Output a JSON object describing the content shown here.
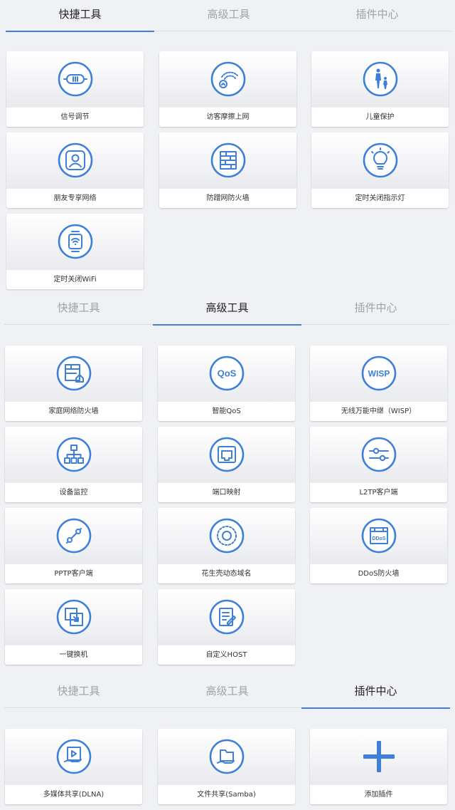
{
  "sections": [
    {
      "tabs": [
        {
          "label": "快捷工具",
          "active": true
        },
        {
          "label": "高级工具",
          "active": false
        },
        {
          "label": "插件中心",
          "active": false
        }
      ],
      "cards": [
        {
          "label": "信号调节",
          "icon": "signal-adjust-icon"
        },
        {
          "label": "访客摩擦上网",
          "icon": "guest-wifi-icon"
        },
        {
          "label": "儿童保护",
          "icon": "child-protect-icon"
        },
        {
          "label": "朋友专享网络",
          "icon": "friend-network-icon"
        },
        {
          "label": "防蹭网防火墙",
          "icon": "firewall-icon"
        },
        {
          "label": "定时关闭指示灯",
          "icon": "bulb-icon"
        },
        {
          "label": "定时关闭WiFi",
          "icon": "watch-wifi-icon"
        }
      ]
    },
    {
      "tabs": [
        {
          "label": "快捷工具",
          "active": false
        },
        {
          "label": "高级工具",
          "active": true
        },
        {
          "label": "插件中心",
          "active": false
        }
      ],
      "cards": [
        {
          "label": "家庭网络防火墙",
          "icon": "home-firewall-icon"
        },
        {
          "label": "智能QoS",
          "icon": "qos-icon",
          "icon_text": "QoS"
        },
        {
          "label": "无线万能中继（WISP）",
          "icon": "wisp-icon",
          "icon_text": "WISP"
        },
        {
          "label": "设备监控",
          "icon": "device-monitor-icon"
        },
        {
          "label": "端口映射",
          "icon": "port-mapping-icon"
        },
        {
          "label": "L2TP客户端",
          "icon": "sliders-icon"
        },
        {
          "label": "PPTP客户端",
          "icon": "link-icon"
        },
        {
          "label": "花生壳动态域名",
          "icon": "dynamic-dns-icon"
        },
        {
          "label": "DDoS防火墙",
          "icon": "ddos-icon",
          "icon_text": "DDoS"
        },
        {
          "label": "一键换机",
          "icon": "switch-device-icon"
        },
        {
          "label": "自定义HOST",
          "icon": "edit-host-icon"
        }
      ]
    },
    {
      "tabs": [
        {
          "label": "快捷工具",
          "active": false
        },
        {
          "label": "高级工具",
          "active": false
        },
        {
          "label": "插件中心",
          "active": true
        }
      ],
      "cards": [
        {
          "label": "多媒体共享(DLNA)",
          "icon": "media-share-icon"
        },
        {
          "label": "文件共享(Samba)",
          "icon": "file-share-icon"
        },
        {
          "label": "添加插件",
          "icon": "plus-icon"
        }
      ]
    }
  ],
  "colors": {
    "accent": "#3d7fd9",
    "background": "#f0f1f4",
    "card": "#ffffff"
  }
}
